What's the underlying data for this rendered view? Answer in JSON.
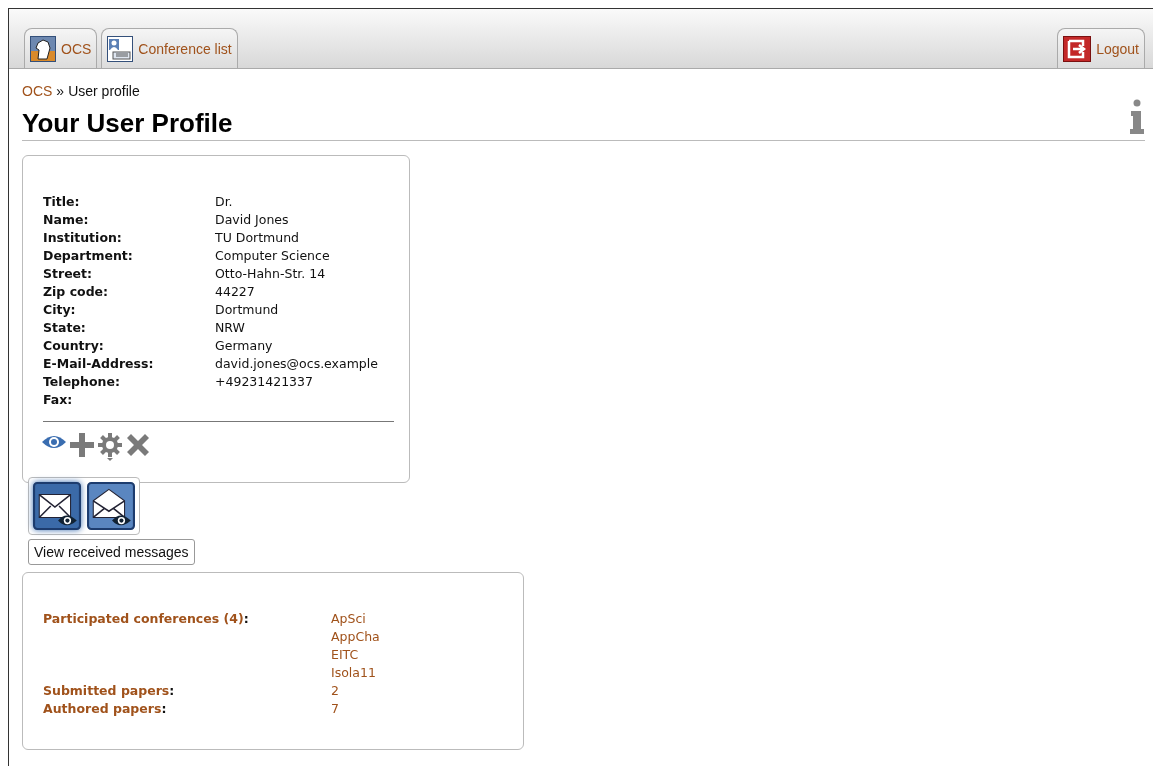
{
  "tabs": [
    {
      "kind": "home",
      "label": "OCS"
    },
    {
      "kind": "list",
      "label": "Conference list"
    }
  ],
  "logout": {
    "label": "Logout"
  },
  "breadcrumb": {
    "link": "OCS",
    "separator": "»",
    "current": "User profile"
  },
  "title": "Your User Profile",
  "profile": [
    {
      "label": "Title:",
      "value": "Dr."
    },
    {
      "label": "Name:",
      "value": "David Jones"
    },
    {
      "label": "Institution:",
      "value": "TU Dortmund"
    },
    {
      "label": "Department:",
      "value": "Computer Science"
    },
    {
      "label": "Street:",
      "value": "Otto-Hahn-Str. 14"
    },
    {
      "label": "Zip code:",
      "value": "44227"
    },
    {
      "label": "City:",
      "value": "Dortmund"
    },
    {
      "label": "State:",
      "value": "NRW"
    },
    {
      "label": "Country:",
      "value": "Germany"
    },
    {
      "label": "E-Mail-Address:",
      "value": "david.jones@ocs.example"
    },
    {
      "label": "Telephone:",
      "value": "+49231421337"
    },
    {
      "label": "Fax:"
    }
  ],
  "actions": [
    {
      "kind": "view",
      "selected": true
    },
    {
      "kind": "add",
      "selected": false
    },
    {
      "kind": "settings",
      "selected": false
    },
    {
      "kind": "delete",
      "selected": false
    }
  ],
  "submenu": [
    {
      "kind": "received",
      "selected": true
    },
    {
      "kind": "sent",
      "selected": false
    }
  ],
  "tooltip": "View received messages",
  "stats": [
    {
      "label": "Participated conferences (4)",
      "suffix": ":",
      "values": [
        "ApSci",
        "AppCha",
        "EITC",
        "Isola11"
      ]
    },
    {
      "label": "Submitted papers",
      "suffix": ":",
      "values": [
        "2"
      ]
    },
    {
      "label": "Authored papers",
      "suffix": ":",
      "values": [
        "7"
      ]
    }
  ]
}
